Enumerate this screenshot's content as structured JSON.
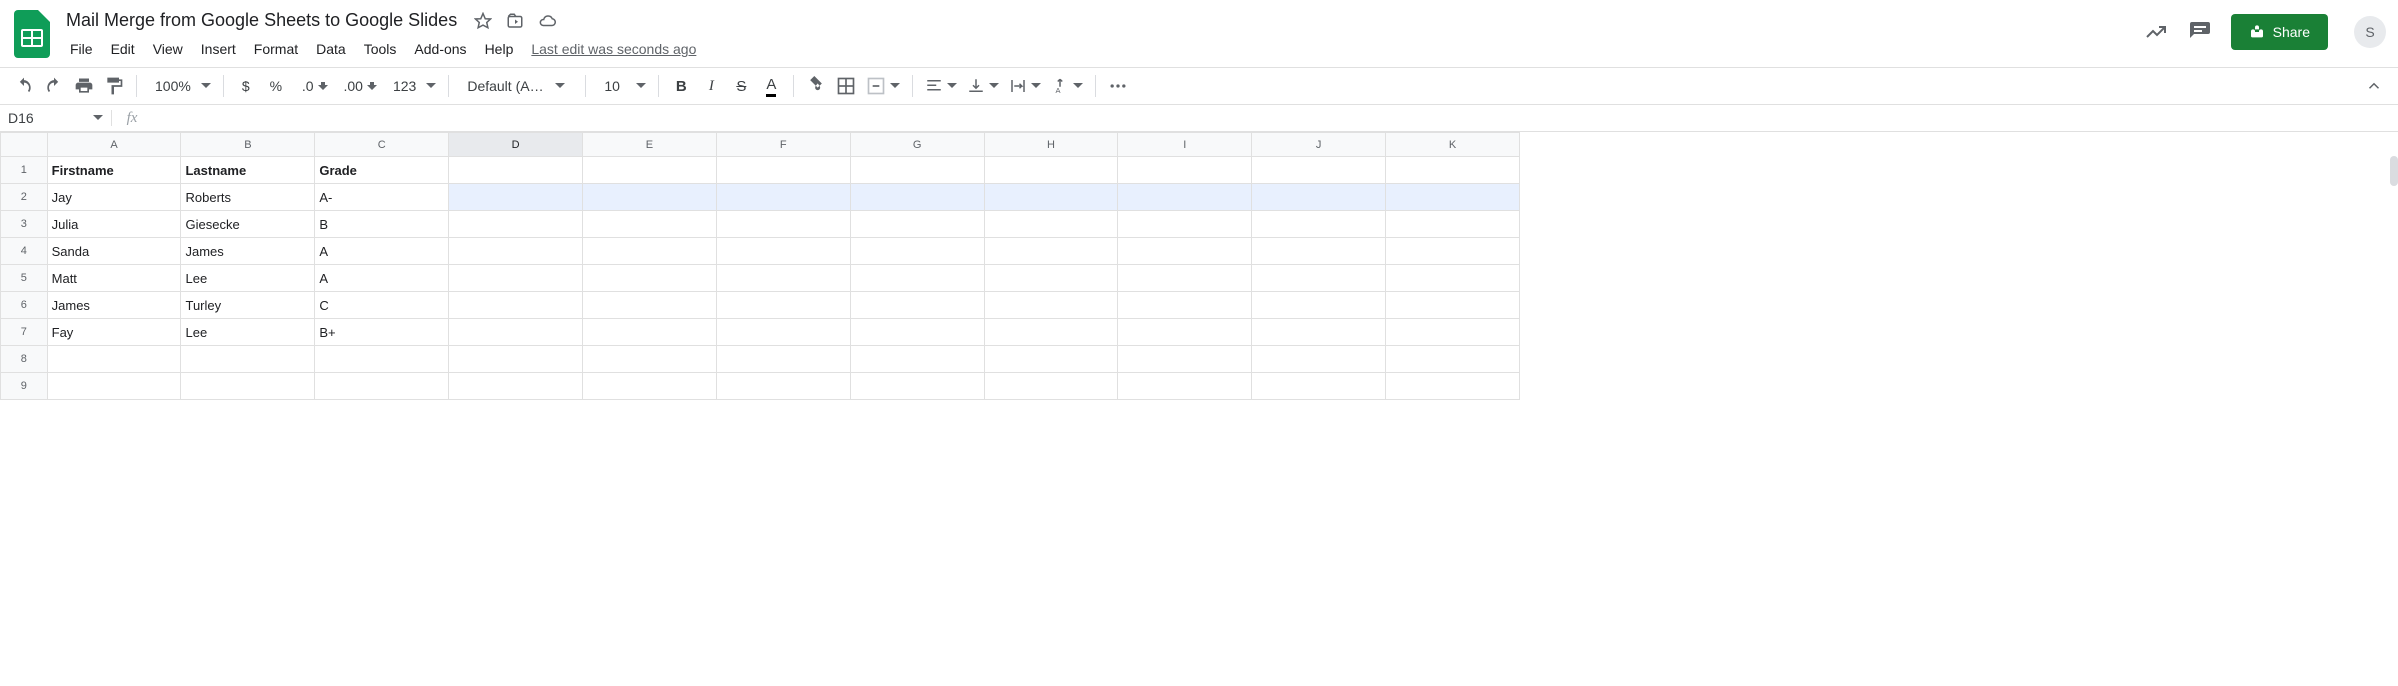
{
  "header": {
    "doc_title": "Mail Merge from Google Sheets to Google Slides",
    "last_edit": "Last edit was seconds ago",
    "share_label": "Share",
    "avatar_initial": "S"
  },
  "menus": [
    "File",
    "Edit",
    "View",
    "Insert",
    "Format",
    "Data",
    "Tools",
    "Add-ons",
    "Help"
  ],
  "toolbar": {
    "zoom": "100%",
    "currency": "$",
    "percent": "%",
    "dec_dec": ".0",
    "inc_dec": ".00",
    "more_fmt": "123",
    "font": "Default (Ari...",
    "font_size": "10"
  },
  "namebox": "D16",
  "columns": [
    "A",
    "B",
    "C",
    "D",
    "E",
    "F",
    "G",
    "H",
    "I",
    "J",
    "K"
  ],
  "selected_col": "D",
  "selected_row_band": 2,
  "rows": [
    {
      "n": 1,
      "bold": true,
      "cells": [
        "Firstname",
        "Lastname",
        "Grade",
        "",
        "",
        "",
        "",
        "",
        "",
        "",
        ""
      ]
    },
    {
      "n": 2,
      "bold": false,
      "cells": [
        "Jay",
        "Roberts",
        "A-",
        "",
        "",
        "",
        "",
        "",
        "",
        "",
        ""
      ]
    },
    {
      "n": 3,
      "bold": false,
      "cells": [
        "Julia",
        "Giesecke",
        "B",
        "",
        "",
        "",
        "",
        "",
        "",
        "",
        ""
      ]
    },
    {
      "n": 4,
      "bold": false,
      "cells": [
        "Sanda",
        "James",
        "A",
        "",
        "",
        "",
        "",
        "",
        "",
        "",
        ""
      ]
    },
    {
      "n": 5,
      "bold": false,
      "cells": [
        "Matt",
        "Lee",
        "A",
        "",
        "",
        "",
        "",
        "",
        "",
        "",
        ""
      ]
    },
    {
      "n": 6,
      "bold": false,
      "cells": [
        "James",
        "Turley",
        "C",
        "",
        "",
        "",
        "",
        "",
        "",
        "",
        ""
      ]
    },
    {
      "n": 7,
      "bold": false,
      "cells": [
        "Fay",
        "Lee",
        "B+",
        "",
        "",
        "",
        "",
        "",
        "",
        "",
        ""
      ]
    },
    {
      "n": 8,
      "bold": false,
      "cells": [
        "",
        "",
        "",
        "",
        "",
        "",
        "",
        "",
        "",
        "",
        ""
      ]
    },
    {
      "n": 9,
      "bold": false,
      "cells": [
        "",
        "",
        "",
        "",
        "",
        "",
        "",
        "",
        "",
        "",
        ""
      ]
    }
  ]
}
